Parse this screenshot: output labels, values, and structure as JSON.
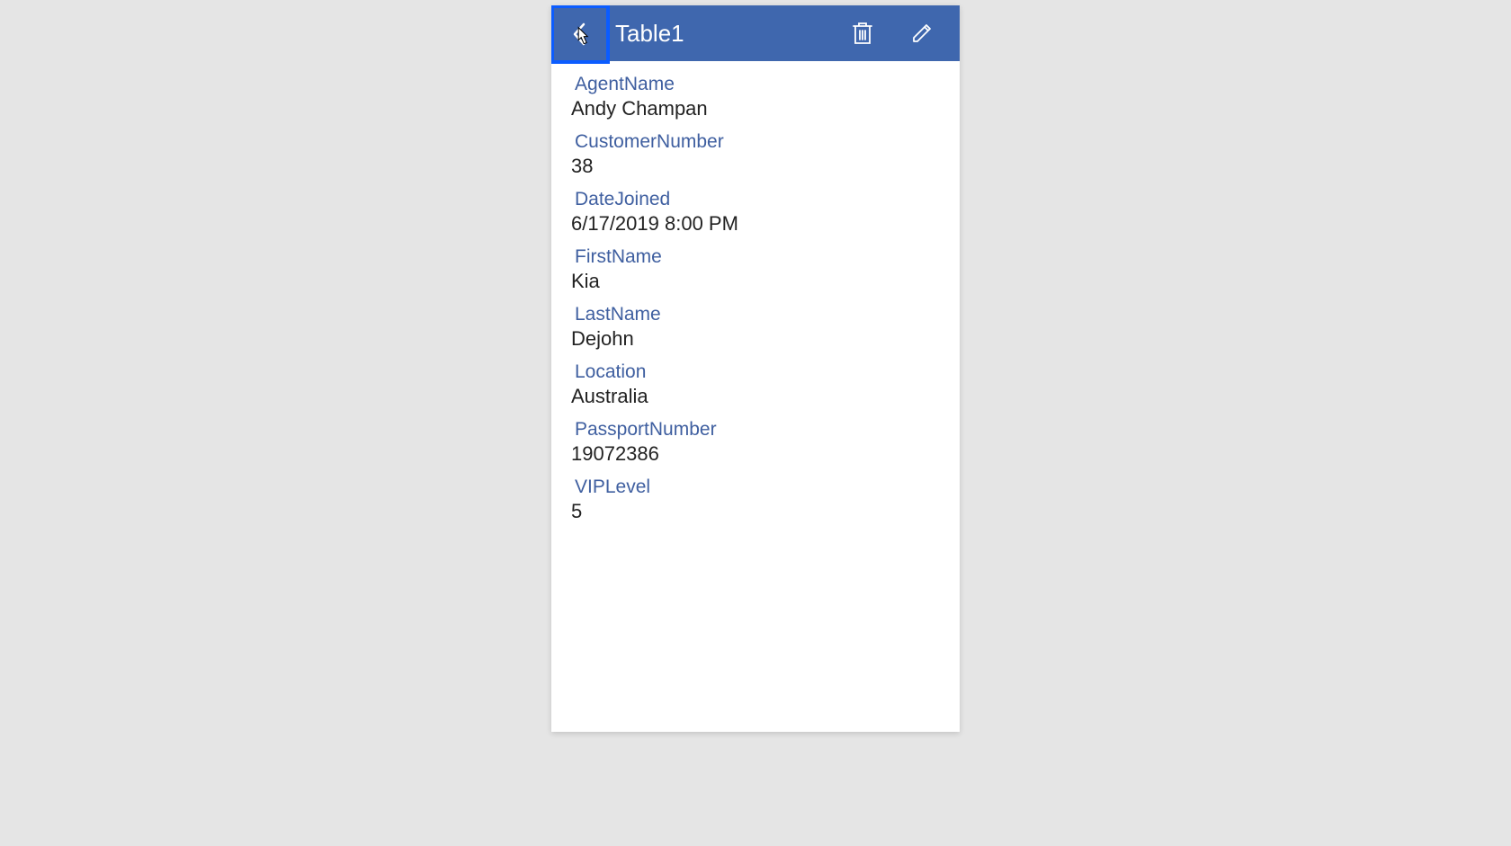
{
  "header": {
    "title": "Table1"
  },
  "fields": [
    {
      "label": "AgentName",
      "value": "Andy Champan"
    },
    {
      "label": "CustomerNumber",
      "value": "38"
    },
    {
      "label": "DateJoined",
      "value": "6/17/2019 8:00 PM"
    },
    {
      "label": "FirstName",
      "value": "Kia"
    },
    {
      "label": "LastName",
      "value": "Dejohn"
    },
    {
      "label": "Location",
      "value": "Australia"
    },
    {
      "label": "PassportNumber",
      "value": "19072386"
    },
    {
      "label": "VIPLevel",
      "value": "5"
    }
  ]
}
